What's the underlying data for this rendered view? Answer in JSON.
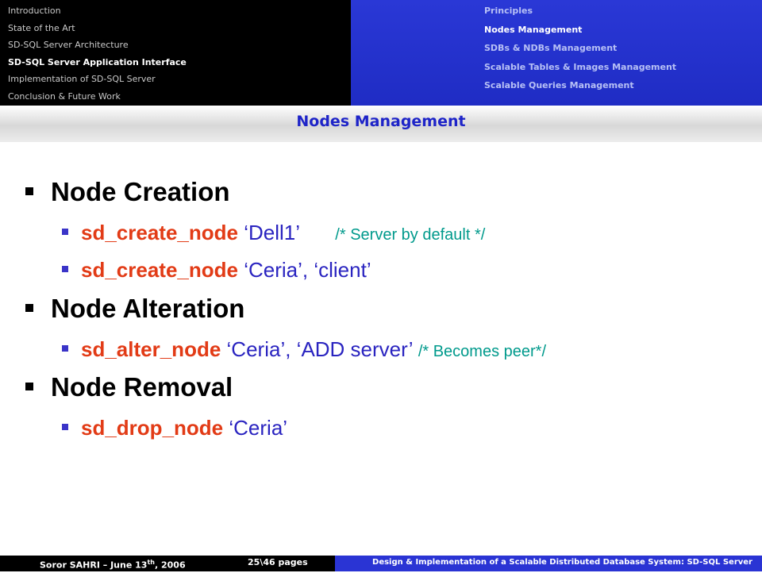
{
  "nav_sections": [
    {
      "label": "Introduction",
      "active": false
    },
    {
      "label": "State of the Art",
      "active": false
    },
    {
      "label": "SD-SQL Server Architecture",
      "active": false
    },
    {
      "label": "SD-SQL Server Application Interface",
      "active": true
    },
    {
      "label": "Implementation of SD-SQL Server",
      "active": false
    },
    {
      "label": "Conclusion & Future Work",
      "active": false
    }
  ],
  "nav_subsections": [
    {
      "label": "Principles",
      "active": false
    },
    {
      "label": "Nodes Management",
      "active": true
    },
    {
      "label": "SDBs & NDBs Management",
      "active": false
    },
    {
      "label": "Scalable Tables & Images Management",
      "active": false
    },
    {
      "label": "Scalable Queries Management",
      "active": false
    }
  ],
  "slide_title": "Nodes Management",
  "content": {
    "creation": {
      "heading": "Node Creation",
      "item1": {
        "cmd": "sd_create_node",
        "args": "‘Dell1’",
        "comment": "/* Server by default */"
      },
      "item2": {
        "cmd": "sd_create_node",
        "args": "‘Ceria’, ‘client’"
      }
    },
    "alteration": {
      "heading": "Node Alteration",
      "item1": {
        "cmd": "sd_alter_node",
        "args": "‘Ceria’, ‘ADD server’",
        "comment": "/* Becomes peer*/"
      }
    },
    "removal": {
      "heading": "Node Removal",
      "item1": {
        "cmd": "sd_drop_node",
        "args": "‘Ceria’"
      }
    }
  },
  "footer": {
    "author": "Soror SAHRI – June 13",
    "author_sup": "th",
    "author_year": ", 2006",
    "pages": "25\\46 pages",
    "title": "Design & Implementation of a Scalable Distributed Database System: SD-SQL Server"
  },
  "colors": {
    "command": "#e23b16",
    "arguments": "#2a24c0",
    "comment": "#009a8c",
    "header_blue": "#2a38d6"
  }
}
